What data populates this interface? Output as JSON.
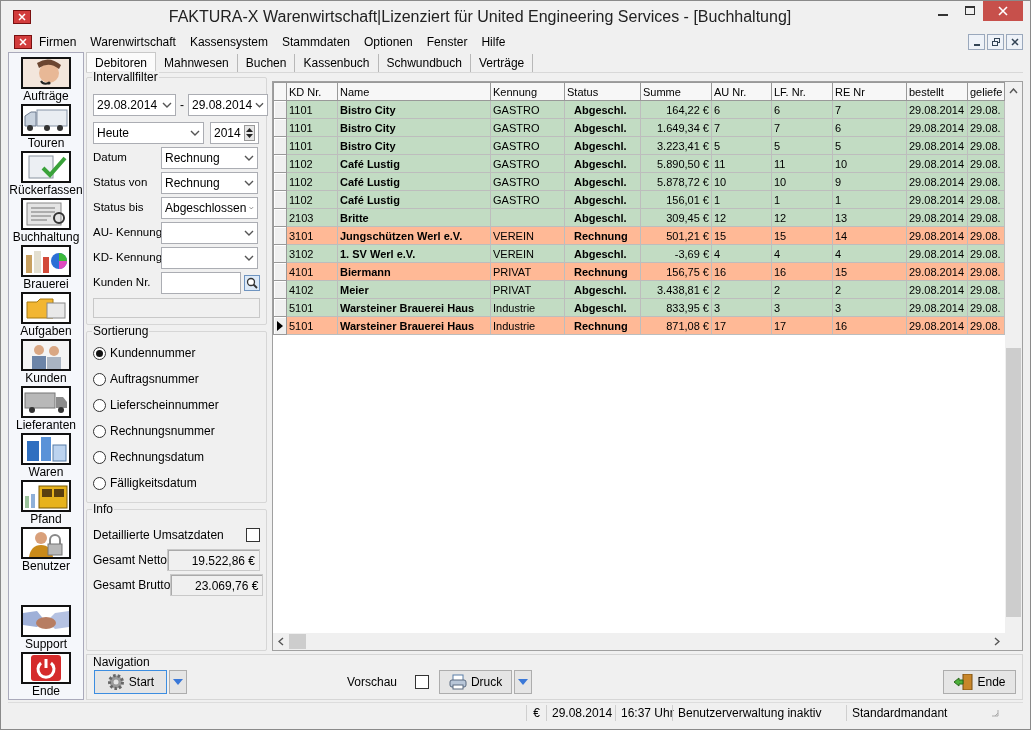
{
  "window": {
    "title": "FAKTURA-X Warenwirtschaft|Lizenziert für United Engineering Services - [Buchhaltung]"
  },
  "menu": [
    "Firmen",
    "Warenwirtschaft",
    "Kassensystem",
    "Stammdaten",
    "Optionen",
    "Fenster",
    "Hilfe"
  ],
  "sidebar": {
    "items": [
      {
        "label": "Aufträge"
      },
      {
        "label": "Touren"
      },
      {
        "label": "Rückerfassen"
      },
      {
        "label": "Buchhaltung"
      },
      {
        "label": "Brauerei"
      },
      {
        "label": "Aufgaben"
      },
      {
        "label": "Kunden"
      },
      {
        "label": "Lieferanten"
      },
      {
        "label": "Waren"
      },
      {
        "label": "Pfand"
      },
      {
        "label": "Benutzer"
      }
    ],
    "bottom_items": [
      {
        "label": "Support"
      },
      {
        "label": "Ende"
      }
    ]
  },
  "tabs": [
    {
      "label": "Debitoren",
      "selected": true
    },
    {
      "label": "Mahnwesen",
      "selected": false
    },
    {
      "label": "Buchen",
      "selected": false
    },
    {
      "label": "Kassenbuch",
      "selected": false
    },
    {
      "label": "Schwundbuch",
      "selected": false
    },
    {
      "label": "Verträge",
      "selected": false
    }
  ],
  "filter": {
    "title": "Intervallfilter",
    "date_from": "29.08.2014",
    "separator": "-",
    "date_to": "29.08.2014",
    "period": "Heute",
    "year": "2014",
    "fields": [
      {
        "label": "Datum",
        "kind": "select",
        "value": "Rechnung"
      },
      {
        "label": "Status von",
        "kind": "select",
        "value": "Rechnung"
      },
      {
        "label": "Status bis",
        "kind": "select",
        "value": "Abgeschlossen"
      },
      {
        "label": "AU- Kennung",
        "kind": "select"
      },
      {
        "label": "KD- Kennung",
        "kind": "select"
      },
      {
        "label": "Kunden Nr.",
        "kind": "lookup"
      }
    ]
  },
  "sorting": {
    "title": "Sortierung",
    "options": [
      {
        "label": "Kundennummer",
        "selected": true
      },
      {
        "label": "Auftragsnummer",
        "selected": false
      },
      {
        "label": "Lieferscheinnummer",
        "selected": false
      },
      {
        "label": "Rechnungsnummer",
        "selected": false
      },
      {
        "label": "Rechnungsdatum",
        "selected": false
      },
      {
        "label": "Fälligkeitsdatum",
        "selected": false
      }
    ]
  },
  "info": {
    "title": "Info",
    "detail_label": "Detaillierte Umsatzdaten",
    "detail_checked": false,
    "totals": [
      {
        "label": "Gesamt Netto",
        "value": "19.522,86 €"
      },
      {
        "label": "Gesamt Brutto",
        "value": "23.069,76 €"
      }
    ]
  },
  "table": {
    "columns": [
      "KD Nr.",
      "Name",
      "Kennung",
      "Status",
      "Summe",
      "AU Nr.",
      "LF. Nr.",
      "RE Nr",
      "bestellt",
      "geliefe"
    ],
    "rows": [
      {
        "cells": [
          "1101",
          "Bistro City",
          "GASTRO",
          "Abgeschl.",
          "164,22 €",
          "6",
          "6",
          "7",
          "29.08.2014",
          "29.08."
        ],
        "color": "#c2dcc3",
        "selected": false
      },
      {
        "cells": [
          "1101",
          "Bistro City",
          "GASTRO",
          "Abgeschl.",
          "1.649,34 €",
          "7",
          "7",
          "6",
          "29.08.2014",
          "29.08."
        ],
        "color": "#c2dcc3",
        "selected": false
      },
      {
        "cells": [
          "1101",
          "Bistro City",
          "GASTRO",
          "Abgeschl.",
          "3.223,41 €",
          "5",
          "5",
          "5",
          "29.08.2014",
          "29.08."
        ],
        "color": "#c2dcc3",
        "selected": false
      },
      {
        "cells": [
          "1102",
          "Café Lustig",
          "GASTRO",
          "Abgeschl.",
          "5.890,50 €",
          "11",
          "11",
          "10",
          "29.08.2014",
          "29.08."
        ],
        "color": "#c2dcc3",
        "selected": false
      },
      {
        "cells": [
          "1102",
          "Café Lustig",
          "GASTRO",
          "Abgeschl.",
          "5.878,72 €",
          "10",
          "10",
          "9",
          "29.08.2014",
          "29.08."
        ],
        "color": "#c2dcc3",
        "selected": false
      },
      {
        "cells": [
          "1102",
          "Café Lustig",
          "GASTRO",
          "Abgeschl.",
          "156,01 €",
          "1",
          "1",
          "1",
          "29.08.2014",
          "29.08."
        ],
        "color": "#c2dcc3",
        "selected": false
      },
      {
        "cells": [
          "2103",
          "Britte",
          null,
          "Abgeschl.",
          "309,45 €",
          "12",
          "12",
          "13",
          "29.08.2014",
          "29.08."
        ],
        "color": "#c2dcc3",
        "selected": false
      },
      {
        "cells": [
          "3101",
          "Jungschützen Werl e.V.",
          "VEREIN",
          "Rechnung",
          "501,21 €",
          "15",
          "15",
          "14",
          "29.08.2014",
          "29.08."
        ],
        "color": "#ffb996",
        "selected": false
      },
      {
        "cells": [
          "3102",
          "1. SV Werl e.V.",
          "VEREIN",
          "Abgeschl.",
          "-3,69 €",
          "4",
          "4",
          "4",
          "29.08.2014",
          "29.08."
        ],
        "color": "#c2dcc3",
        "selected": false
      },
      {
        "cells": [
          "4101",
          "Biermann",
          "PRIVAT",
          "Rechnung",
          "156,75 €",
          "16",
          "16",
          "15",
          "29.08.2014",
          "29.08."
        ],
        "color": "#ffb996",
        "selected": false
      },
      {
        "cells": [
          "4102",
          "Meier",
          "PRIVAT",
          "Abgeschl.",
          "3.438,81 €",
          "2",
          "2",
          "2",
          "29.08.2014",
          "29.08."
        ],
        "color": "#c2dcc3",
        "selected": false
      },
      {
        "cells": [
          "5101",
          "Warsteiner Brauerei Haus",
          "Industrie",
          "Abgeschl.",
          "833,95 €",
          "3",
          "3",
          "3",
          "29.08.2014",
          "29.08."
        ],
        "color": "#c2dcc3",
        "selected": false
      },
      {
        "cells": [
          "5101",
          "Warsteiner Brauerei Haus",
          "Industrie",
          "Rechnung",
          "871,08 €",
          "17",
          "17",
          "16",
          "29.08.2014",
          "29.08."
        ],
        "color": "#ffb996",
        "selected": true
      }
    ]
  },
  "navigation": {
    "title": "Navigation",
    "start_button": "Start",
    "preview_label": "Vorschau",
    "preview_checked": false,
    "print_button": "Druck",
    "exit_button": "Ende"
  },
  "status_bar": [
    "€",
    "29.08.2014",
    "16:37 Uhr",
    "Benutzerverwaltung inaktiv",
    "Standardmandant"
  ]
}
